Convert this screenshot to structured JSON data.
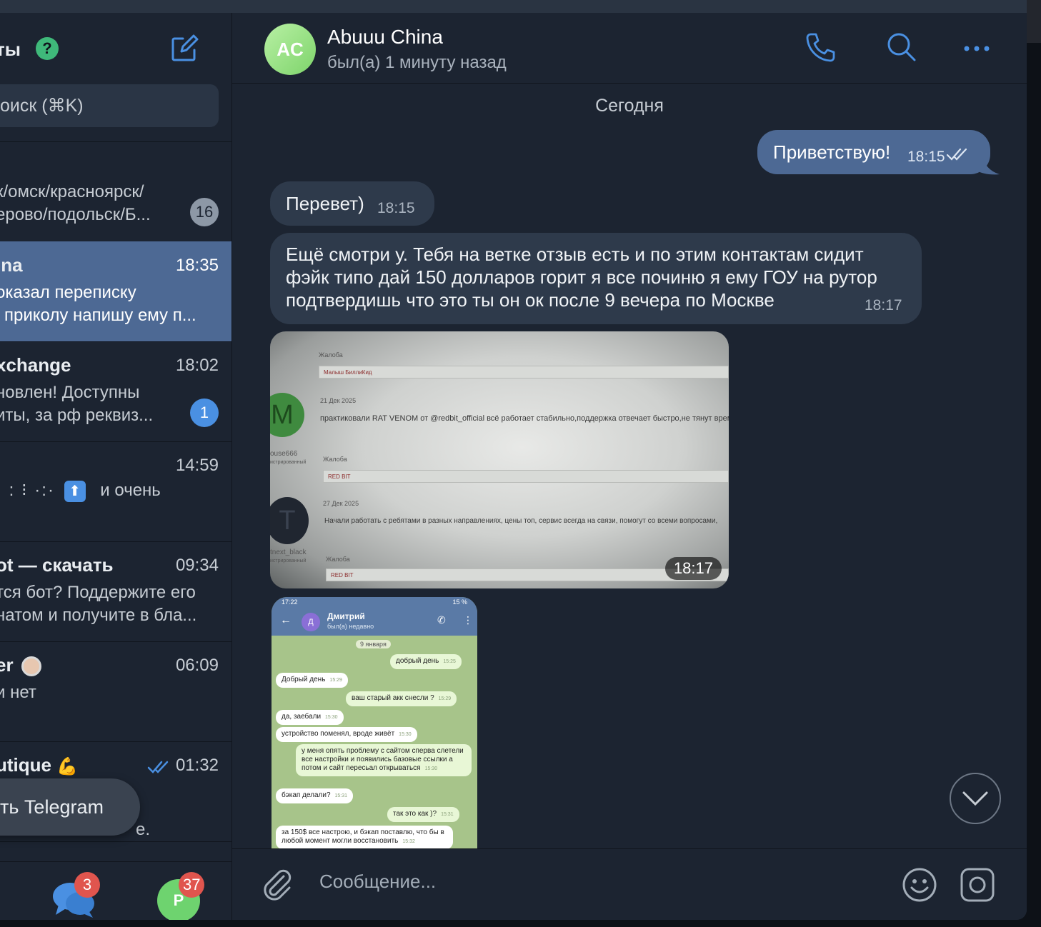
{
  "sidebar": {
    "title": "ты",
    "search_placeholder": "оиск (⌘K)",
    "chats": [
      {
        "name": "",
        "line1": "к/омск/красноярск/",
        "line2": "ерово/подольск/Б...",
        "time": "",
        "unread": "16"
      },
      {
        "name": "ina",
        "line1": "оказал переписку",
        "line2": "приколу напишу ему п...",
        "time": "18:35",
        "unread": ""
      },
      {
        "name": "xchange",
        "line1": "новлен!  Доступны",
        "line2": "иты, за рф реквиз...",
        "time": "18:02",
        "unread": "1"
      },
      {
        "name": "",
        "line1": "и очень",
        "line2": "",
        "time": "14:59",
        "unread": ""
      },
      {
        "name": "ot — скачать",
        "line1": "тся бот? Поддержите его",
        "line2": "натом и получите в бла...",
        "time": "09:34",
        "unread": ""
      },
      {
        "name": "er",
        "line1": "и нет",
        "line2": "",
        "time": "06:09",
        "unread": ""
      },
      {
        "name": "utique",
        "line1": "е.",
        "line2": "",
        "time": "01:32",
        "unread": ""
      }
    ],
    "toast": "ть Telegram",
    "bottom": {
      "chats_badge": "3",
      "profile_initial": "Р",
      "profile_badge": "37"
    }
  },
  "chat": {
    "avatar_initials": "AC",
    "name": "Abuuu China",
    "status": "был(а) 1 минуту назад",
    "date_separator": "Сегодня",
    "messages": [
      {
        "dir": "out",
        "text": "Приветствую!",
        "time": "18:15"
      },
      {
        "dir": "in",
        "text": "Перевет)",
        "time": "18:15"
      },
      {
        "dir": "in",
        "lines": [
          "Ещё смотри у. Тебя на ветке отзыв есть и по этим контактам сидит",
          "фэйк типо дай 150 долларов горит я все починю я ему ГОУ на рутор",
          "подтвердишь что это ты он ок после 9 вечера по Москве"
        ],
        "time": "18:17"
      }
    ],
    "photo1": {
      "time": "18:17",
      "label_complaint": "Жалоба",
      "reaction1": "Малыш БиллиКид",
      "post1_date": "21 Дек 2025",
      "post1_text": "практиковали RAT VENOM от @redbit_official всё работает стабильно,поддержка отвечает быстро,не тянут время и р",
      "post1_user": "ouse666",
      "post1_role": "истрированный",
      "reaction2": "RED BIT",
      "post2_date": "27 Дек 2025",
      "post2_text": "Начали работать с ребятами в разных направлениях, цены топ, сервис всегда на связи, помогут со всеми вопросами,",
      "post2_user": "tnext_black",
      "post2_role": "истрированный",
      "reaction3": "RED BIT"
    },
    "photo2": {
      "status_time": "17:22",
      "status_right": "15 %",
      "contact": "Дмитрий",
      "contact_initial": "Д",
      "contact_status": "был(а) недавно",
      "date": "9 января",
      "messages": [
        {
          "dir": "out",
          "text": "добрый день",
          "time": "15:25"
        },
        {
          "dir": "in",
          "text": "Добрый день",
          "time": "15:29"
        },
        {
          "dir": "out",
          "text": "ваш старый акк снесли ?",
          "time": "15:29"
        },
        {
          "dir": "in",
          "text": "да, заебали",
          "time": "15:30"
        },
        {
          "dir": "in",
          "text": "устройство поменял, вроде живёт",
          "time": "15:30"
        },
        {
          "dir": "out",
          "text": "у меня опять проблему с сайтом сперва слетели все настройки и появились базовые ссылки а потом и сайт пересьал открываться",
          "time": "15:30"
        },
        {
          "dir": "in",
          "text": "бэкап делали?",
          "time": "15:31"
        },
        {
          "dir": "out",
          "text": "так это как )?",
          "time": "15:31"
        },
        {
          "dir": "in",
          "text": "за 150$ все настрою, и бэкап поставлю, что бы в любой момент могли восстановить",
          "time": "15:32"
        }
      ]
    },
    "composer_placeholder": "Сообщение..."
  },
  "colors": {
    "accent": "#4a90e2",
    "active_row": "#4d6994",
    "outgoing": "#4d6994",
    "incoming": "#2e3a4b",
    "badge": "#e0554e"
  }
}
